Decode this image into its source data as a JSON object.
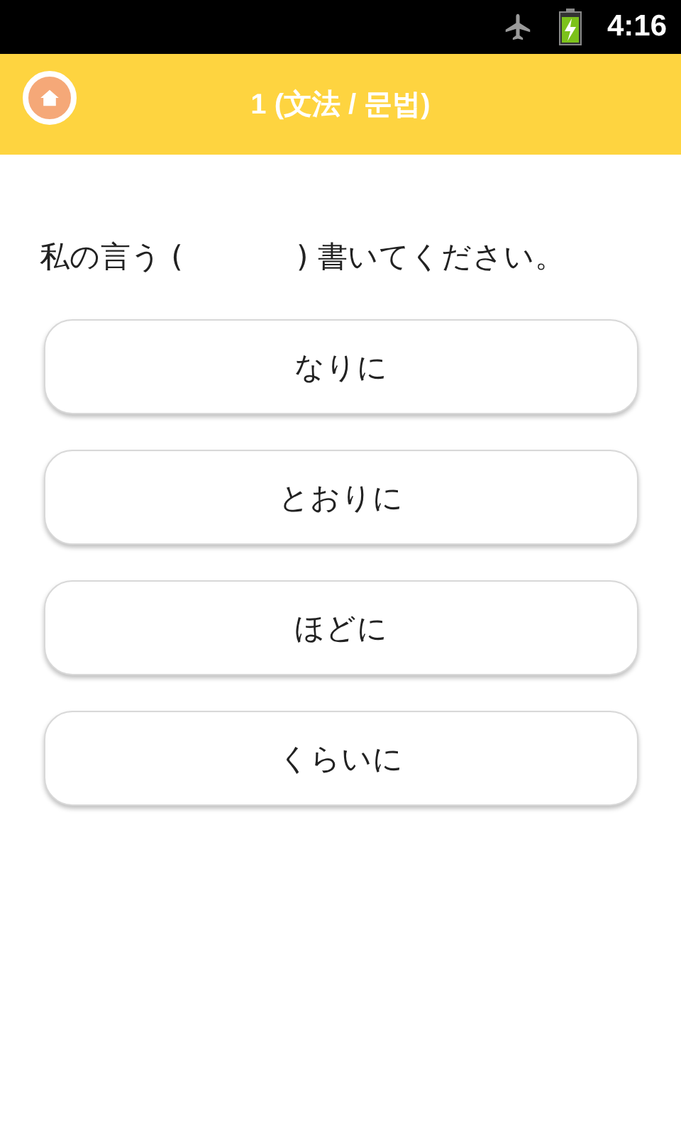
{
  "status_bar": {
    "time": "4:16"
  },
  "header": {
    "title": "1 (文法 / 문법)"
  },
  "question": "私の言う (            ) 書いてください。",
  "options": [
    {
      "label": "なりに"
    },
    {
      "label": "とおりに"
    },
    {
      "label": "ほどに"
    },
    {
      "label": "くらいに"
    }
  ]
}
